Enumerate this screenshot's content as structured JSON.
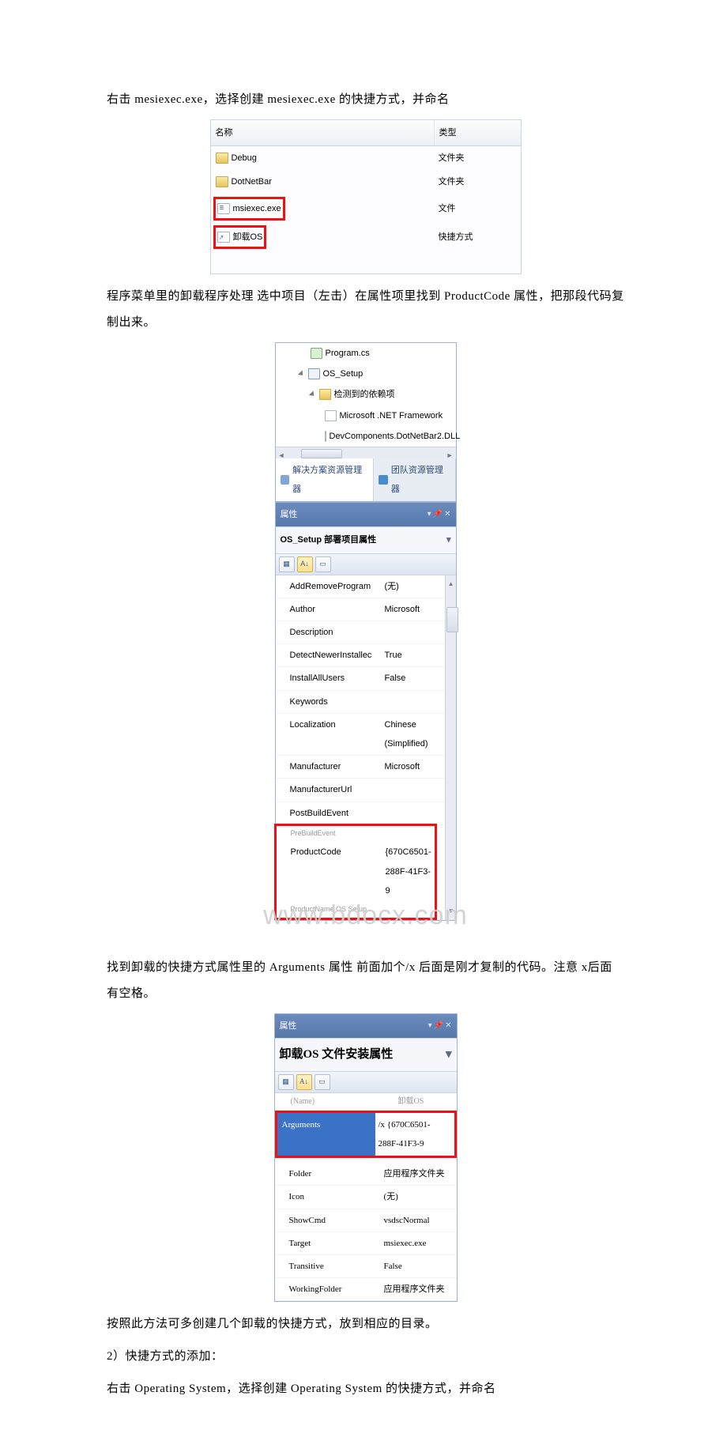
{
  "para1": "右击 mesiexec.exe，选择创建 mesiexec.exe 的快捷方式，并命名",
  "filelist": {
    "headers": {
      "name": "名称",
      "type": "类型"
    },
    "rows": [
      {
        "name": "Debug",
        "type": "文件夹",
        "icon": "folder"
      },
      {
        "name": "DotNetBar",
        "type": "文件夹",
        "icon": "folder"
      },
      {
        "name": "msiexec.exe",
        "type": "文件",
        "icon": "file",
        "highlight": true
      },
      {
        "name": "卸载OS",
        "type": "快捷方式",
        "icon": "shortcut",
        "highlight": true
      }
    ]
  },
  "para2": "程序菜单里的卸载程序处理 选中项目（左击）在属性项里找到 ProductCode 属性，把那段代码复制出来。",
  "vs": {
    "tree": {
      "program": "Program.cs",
      "setup": "OS_Setup",
      "deps_title": "检测到的依赖项",
      "dep1": "Microsoft .NET Framework",
      "dep2": "DevComponents.DotNetBar2.DLL"
    },
    "footer_tabs": {
      "sol": "解决方案资源管理器",
      "team": "团队资源管理器"
    },
    "prop_title": "属性",
    "prop_sub": "OS_Setup 部署项目属性",
    "rows": [
      {
        "k": "AddRemoveProgram",
        "v": "(无)"
      },
      {
        "k": "Author",
        "v": "Microsoft"
      },
      {
        "k": "Description",
        "v": ""
      },
      {
        "k": "DetectNewerInstallec",
        "v": "True"
      },
      {
        "k": "InstallAllUsers",
        "v": "False"
      },
      {
        "k": "Keywords",
        "v": ""
      },
      {
        "k": "Localization",
        "v": "Chinese (Simplified)"
      },
      {
        "k": "Manufacturer",
        "v": "Microsoft"
      },
      {
        "k": "ManufacturerUrl",
        "v": ""
      },
      {
        "k": "PostBuildEvent",
        "v": ""
      }
    ],
    "productcode": {
      "k": "ProductCode",
      "v": "{670C6501-288F-41F3-9"
    },
    "faded_bottom": "ProductName            OS Setup"
  },
  "watermark": "www.bdocx.com",
  "para3": "找到卸载的快捷方式属性里的 Arguments 属性 前面加个/x 后面是刚才复制的代码。注意 x后面有空格。",
  "vs3": {
    "prop_title": "属性",
    "prop_sub": "卸载OS 文件安装属性",
    "name_row": {
      "k": "(Name)",
      "v": "卸载OS"
    },
    "arg_row": {
      "k": "Arguments",
      "v": "/x {670C6501-288F-41F3-9"
    },
    "rows": [
      {
        "k": "Folder",
        "v": "应用程序文件夹"
      },
      {
        "k": "Icon",
        "v": "(无)"
      },
      {
        "k": "ShowCmd",
        "v": "vsdscNormal"
      },
      {
        "k": "Target",
        "v": "msiexec.exe"
      },
      {
        "k": "Transitive",
        "v": "False"
      },
      {
        "k": "WorkingFolder",
        "v": "应用程序文件夹"
      }
    ]
  },
  "para4": "按照此方法可多创建几个卸载的快捷方式，放到相应的目录。",
  "para5": "2）快捷方式的添加：",
  "para6": "右击 Operating System，选择创建 Operating System 的快捷方式，并命名"
}
